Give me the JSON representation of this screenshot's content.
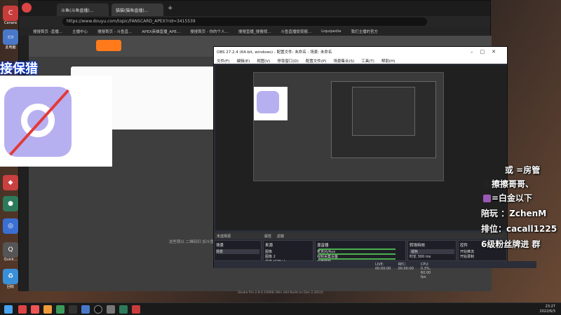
{
  "desktop": {
    "icons": [
      {
        "label": "Canara"
      },
      {
        "label": "此电脑"
      },
      {
        "label": ""
      },
      {
        "label": ""
      },
      {
        "label": ""
      },
      {
        "label": ""
      },
      {
        "label": ""
      },
      {
        "label": ""
      },
      {
        "label": "Quick..."
      },
      {
        "label": "回收"
      }
    ]
  },
  "browser": {
    "tabs": [
      {
        "label": "斗鱼(斗鱼直播)..."
      },
      {
        "label": "猫猫(猫鱼直播)..."
      }
    ],
    "url": "https://www.douyu.com/topic/FANSCARD_APEX?rid=3415539",
    "bookmarks": [
      "搜搜首页 -直播...",
      "主播中心",
      "搜搜首页 - 斗鱼直...",
      "APEX英雄直播_APE...",
      "搜搜首页 - 你的个人...",
      "搜搜直播_搜搜视...",
      "斗鱼直播提现报...",
      "Liquipedia",
      "我们主播的官方"
    ],
    "page_footer": "这些我以 二维码扫 加斗鱼"
  },
  "overlay": {
    "live_title": "接保猎"
  },
  "obs": {
    "title": "OBS 27.2.4 (64-bit, windows) - 配置文件: 未命名 - 场景: 未命名",
    "menu": [
      "文件(F)",
      "编辑(E)",
      "视图(V)",
      "停靠窗口(D)",
      "配置文件(P)",
      "场景集合(S)",
      "工具(T)",
      "帮助(H)"
    ],
    "strip": [
      "未选择源",
      "属性",
      "滤镜"
    ],
    "docks": [
      {
        "title": "场景",
        "items": [
          "场景"
        ]
      },
      {
        "title": "来源",
        "items": [
          "图像",
          "图像 2",
          "文字 (GDI+)",
          "视频采集设备",
          "文字 (GDI+)",
          "文字 (GDI+)",
          "窗口采集",
          "窗口采集",
          "显示器采集"
        ]
      },
      {
        "title": "混音器",
        "items": [
          "麦克风/Aux",
          "视频采集设备",
          "桌面音频"
        ]
      },
      {
        "title": "转场特效",
        "items": [
          "褪色",
          "时长 300 ms"
        ]
      },
      {
        "title": "控件",
        "items": [
          "开始推流",
          "开始录制",
          "启动虚拟摄像机",
          "工作室模式",
          "设置",
          "退出"
        ]
      }
    ],
    "status": [
      "LIVE: 00:00:00",
      "REC: 00:00:00",
      "CPU: 0.3%, 60.00 fps"
    ]
  },
  "right_overlay": {
    "line1": "或  =房管",
    "line2": "擦擦哥哥、",
    "line3": "=白金以下",
    "line4": "陪玩  ：ZchenM",
    "line5": "排位：cacall1225",
    "line6": "6级粉丝牌进  群"
  },
  "taskbar": {
    "time": "23:27",
    "date": "2022/6/3"
  },
  "footer_text": "Studio Pro 2.8.4.10068 (Win x64 Build on Dec 2.2014)",
  "colors": {
    "accent": "#e23a3a",
    "badge": "#b7b0f0",
    "obs_bg": "#2b2e38"
  }
}
